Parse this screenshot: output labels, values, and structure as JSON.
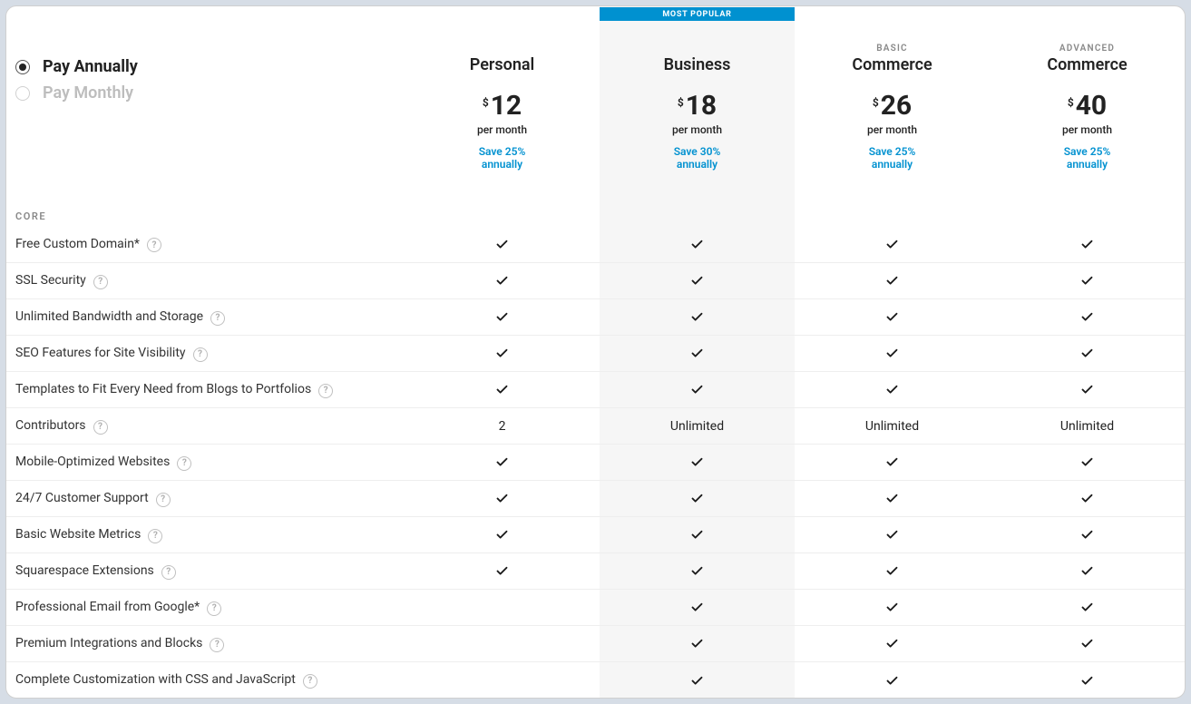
{
  "billing": {
    "annual_label": "Pay Annually",
    "monthly_label": "Pay Monthly",
    "selected": "annual"
  },
  "badge_label": "MOST POPULAR",
  "currency_symbol": "$",
  "per_label": "per month",
  "save_prefix": "Save ",
  "save_suffix_line2": "annually",
  "plans": [
    {
      "sub": "",
      "name": "Personal",
      "price": "12",
      "save": "25%",
      "highlight": false
    },
    {
      "sub": "",
      "name": "Business",
      "price": "18",
      "save": "30%",
      "highlight": true,
      "badge": true
    },
    {
      "sub": "BASIC",
      "name": "Commerce",
      "price": "26",
      "save": "25%",
      "highlight": false
    },
    {
      "sub": "ADVANCED",
      "name": "Commerce",
      "price": "40",
      "save": "25%",
      "highlight": false
    }
  ],
  "section_title": "CORE",
  "features": [
    {
      "label": "Free Custom Domain*",
      "help": true,
      "values": [
        "check",
        "check",
        "check",
        "check"
      ]
    },
    {
      "label": "SSL Security",
      "help": true,
      "values": [
        "check",
        "check",
        "check",
        "check"
      ]
    },
    {
      "label": "Unlimited Bandwidth and Storage",
      "help": true,
      "values": [
        "check",
        "check",
        "check",
        "check"
      ]
    },
    {
      "label": "SEO Features for Site Visibility",
      "help": true,
      "values": [
        "check",
        "check",
        "check",
        "check"
      ]
    },
    {
      "label": "Templates to Fit Every Need from Blogs to Portfolios",
      "help": true,
      "values": [
        "check",
        "check",
        "check",
        "check"
      ]
    },
    {
      "label": "Contributors",
      "help": true,
      "values": [
        "2",
        "Unlimited",
        "Unlimited",
        "Unlimited"
      ]
    },
    {
      "label": "Mobile-Optimized Websites",
      "help": true,
      "values": [
        "check",
        "check",
        "check",
        "check"
      ]
    },
    {
      "label": "24/7 Customer Support",
      "help": true,
      "values": [
        "check",
        "check",
        "check",
        "check"
      ]
    },
    {
      "label": "Basic Website Metrics",
      "help": true,
      "values": [
        "check",
        "check",
        "check",
        "check"
      ]
    },
    {
      "label": "Squarespace Extensions",
      "help": true,
      "values": [
        "check",
        "check",
        "check",
        "check"
      ]
    },
    {
      "label": "Professional Email from Google*",
      "help": true,
      "values": [
        "",
        "check",
        "check",
        "check"
      ]
    },
    {
      "label": "Premium Integrations and Blocks",
      "help": true,
      "values": [
        "",
        "check",
        "check",
        "check"
      ]
    },
    {
      "label": "Complete Customization with CSS and JavaScript",
      "help": true,
      "values": [
        "",
        "check",
        "check",
        "check"
      ]
    }
  ]
}
